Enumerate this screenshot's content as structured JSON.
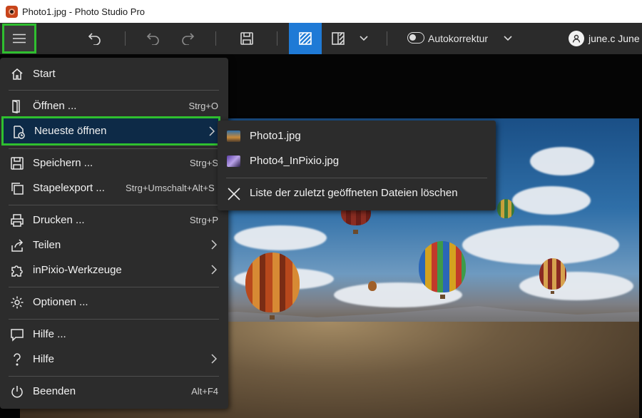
{
  "window": {
    "title": "Photo1.jpg - Photo Studio Pro"
  },
  "toolbar": {
    "menu_icon": "hamburger-icon",
    "undo_icon": "undo-icon",
    "undo2_icon": "undo-icon",
    "redo_icon": "redo-icon",
    "save_icon": "save-icon",
    "view_single_icon": "view-pattern-icon",
    "view_compare_icon": "split-view-icon",
    "autocorrect_label": "Autokorrektur",
    "user_name": "june.c June",
    "accent_color": "#1f7ad6",
    "highlight_color": "#2fbf2f"
  },
  "menu": {
    "start": {
      "label": "Start",
      "icon": "home-icon"
    },
    "open": {
      "label": "Öffnen ...",
      "shortcut": "Strg+O",
      "icon": "open-door-icon"
    },
    "recent": {
      "label": "Neueste öffnen",
      "icon": "recent-files-icon"
    },
    "save": {
      "label": "Speichern ...",
      "shortcut": "Strg+S",
      "icon": "save-icon"
    },
    "batch": {
      "label": "Stapelexport ...",
      "shortcut": "Strg+Umschalt+Alt+S",
      "icon": "batch-export-icon"
    },
    "print": {
      "label": "Drucken ...",
      "shortcut": "Strg+P",
      "icon": "print-icon"
    },
    "share": {
      "label": "Teilen",
      "icon": "share-icon"
    },
    "tools": {
      "label": "inPixio-Werkzeuge",
      "icon": "puzzle-icon"
    },
    "options": {
      "label": "Optionen ...",
      "icon": "gear-icon"
    },
    "help1": {
      "label": "Hilfe ...",
      "icon": "chat-icon"
    },
    "help2": {
      "label": "Hilfe",
      "icon": "question-icon"
    },
    "exit": {
      "label": "Beenden",
      "shortcut": "Alt+F4",
      "icon": "power-icon"
    }
  },
  "submenu": {
    "items": [
      {
        "label": "Photo1.jpg"
      },
      {
        "label": "Photo4_InPixio.jpg"
      }
    ],
    "clear_label": "Liste der zuletzt geöffneten Dateien löschen"
  }
}
